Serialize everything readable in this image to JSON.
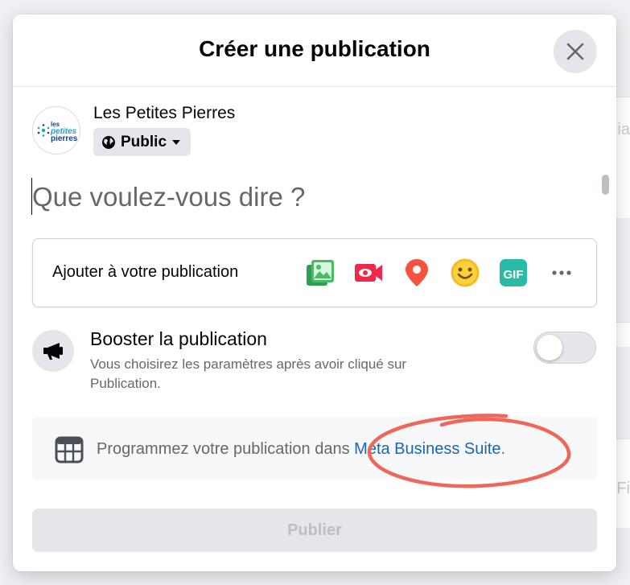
{
  "dialog": {
    "title": "Créer une publication"
  },
  "author": {
    "name": "Les Petites Pierres",
    "logo_lines": [
      "les",
      "petites",
      "pierres"
    ],
    "audience_label": "Public"
  },
  "composer": {
    "placeholder": "Que voulez-vous dire ?"
  },
  "add_to_post": {
    "label": "Ajouter à votre publication",
    "icons": [
      "photo-video-icon",
      "live-video-icon",
      "location-pin-icon",
      "feeling-emoji-icon",
      "gif-icon",
      "more-icon"
    ],
    "gif_text": "GIF"
  },
  "boost": {
    "title": "Booster la publication",
    "description": "Vous choisirez les paramètres après avoir cliqué sur Publication.",
    "enabled": false
  },
  "schedule": {
    "text": "Programmez votre publication dans ",
    "link": "Meta Business Suite",
    "suffix": "."
  },
  "publish_button": {
    "label": "Publier",
    "disabled": true
  },
  "background": {
    "fragments": [
      "ia",
      "Fi"
    ]
  },
  "colors": {
    "link": "#1b64b4",
    "photo": "#45bd62",
    "live": "#f02849",
    "location": "#f5533d",
    "feeling": "#f7b928",
    "gif": "#2abba7",
    "annotation": "#f0675a"
  }
}
